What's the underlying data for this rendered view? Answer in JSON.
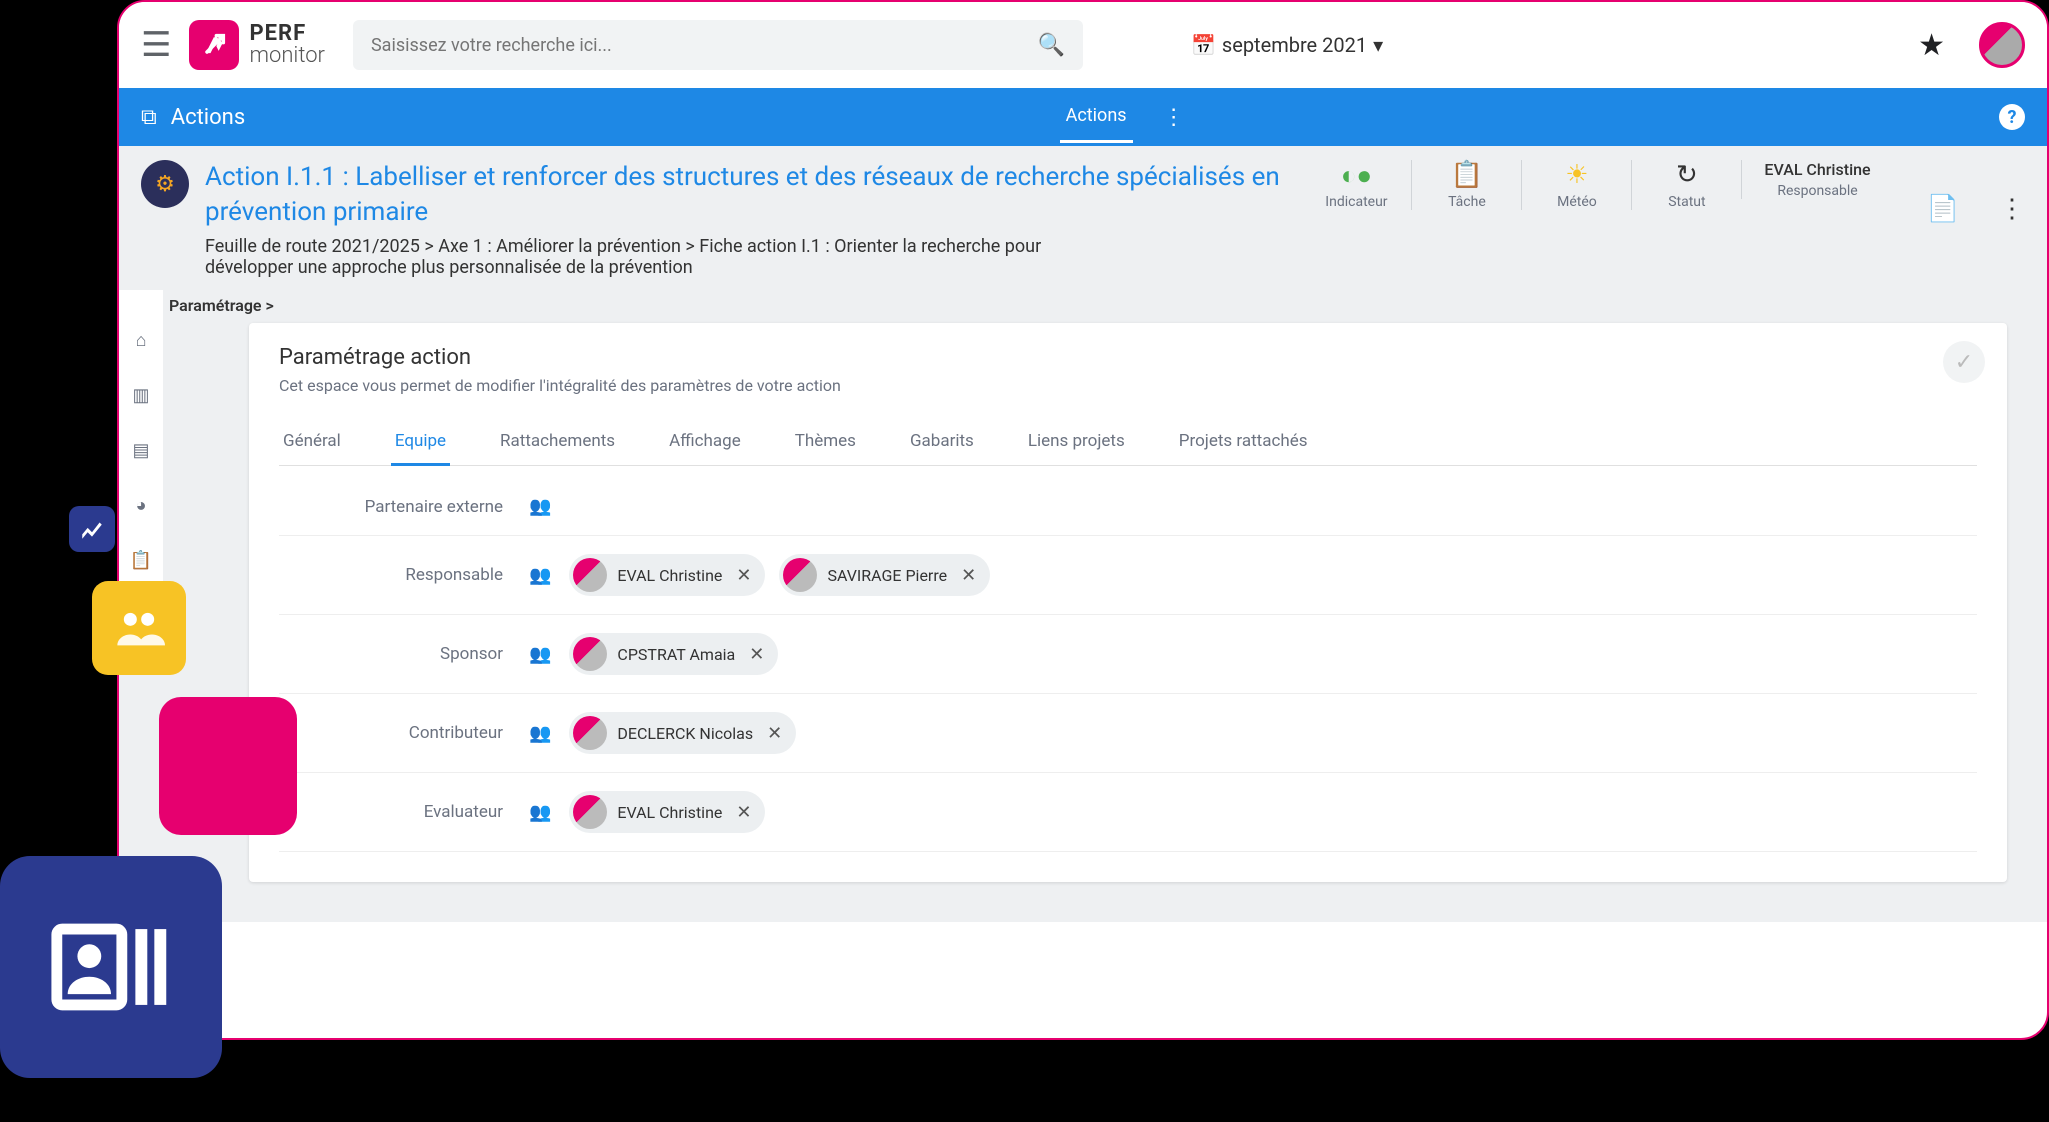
{
  "header": {
    "app_name_line1": "PERF",
    "app_name_line2": "monitor",
    "search_placeholder": "Saisissez votre recherche ici...",
    "date_label": "septembre 2021"
  },
  "blue_bar": {
    "section": "Actions",
    "tab": "Actions"
  },
  "action": {
    "title": "Action I.1.1 : Labelliser et renforcer des structures et des réseaux de recherche spécialisés en prévention primaire",
    "path": "Feuille de route 2021/2025 > Axe 1 : Améliorer la prévention > Fiche action I.1 : Orienter la recherche pour développer une approche plus personnalisée de la prévention"
  },
  "metrics": {
    "indicateur": "Indicateur",
    "tache": "Tâche",
    "meteo": "Météo",
    "statut": "Statut",
    "responsable_label": "Responsable",
    "responsable_value": "EVAL Christine"
  },
  "sub_breadcrumb": "Paramétrage >",
  "panel": {
    "title": "Paramétrage action",
    "subtitle": "Cet espace vous permet de modifier l'intégralité des paramètres de votre action"
  },
  "tabs": [
    "Général",
    "Equipe",
    "Rattachements",
    "Affichage",
    "Thèmes",
    "Gabarits",
    "Liens projets",
    "Projets rattachés"
  ],
  "active_tab_index": 1,
  "roles": [
    {
      "label": "Partenaire externe",
      "people": []
    },
    {
      "label": "Responsable",
      "people": [
        "EVAL Christine",
        "SAVIRAGE Pierre"
      ]
    },
    {
      "label": "Sponsor",
      "people": [
        "CPSTRAT Amaia"
      ]
    },
    {
      "label": "Contributeur",
      "people": [
        "DECLERCK Nicolas"
      ]
    },
    {
      "label": "Evaluateur",
      "people": [
        "EVAL Christine"
      ]
    }
  ]
}
